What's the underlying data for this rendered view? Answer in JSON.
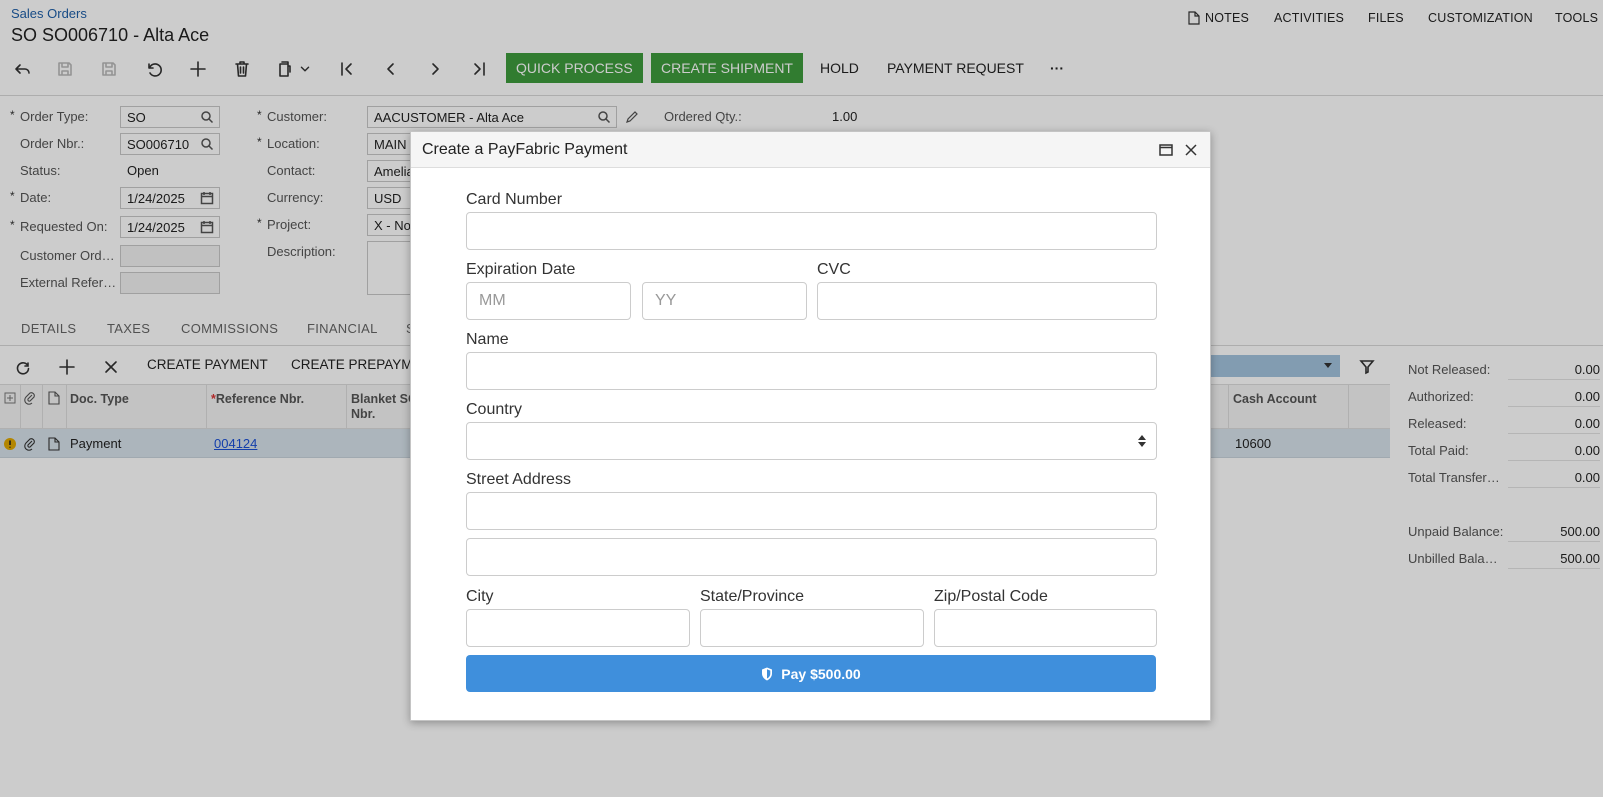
{
  "header": {
    "breadcrumb": "Sales Orders",
    "title": "SO SO006710 - Alta Ace",
    "top_buttons": {
      "notes": "NOTES",
      "activities": "ACTIVITIES",
      "files": "FILES",
      "customization": "CUSTOMIZATION",
      "tools": "TOOLS"
    }
  },
  "toolbar": {
    "quick_process": "QUICK PROCESS",
    "create_shipment": "CREATE SHIPMENT",
    "hold": "HOLD",
    "payment_request": "PAYMENT REQUEST",
    "more": "···"
  },
  "form": {
    "order_type": {
      "label": "Order Type:",
      "value": "SO"
    },
    "order_nbr": {
      "label": "Order Nbr.:",
      "value": "SO006710"
    },
    "status": {
      "label": "Status:",
      "value": "Open"
    },
    "date": {
      "label": "Date:",
      "value": "1/24/2025"
    },
    "requested_on": {
      "label": "Requested On:",
      "value": "1/24/2025"
    },
    "customer_ord": {
      "label": "Customer Ord…",
      "value": ""
    },
    "external_ref": {
      "label": "External Refer…",
      "value": ""
    },
    "customer": {
      "label": "Customer:",
      "value": "AACUSTOMER - Alta Ace"
    },
    "location": {
      "label": "Location:",
      "value": "MAIN"
    },
    "contact": {
      "label": "Contact:",
      "value": "Amelia"
    },
    "currency": {
      "label": "Currency:",
      "value": "USD"
    },
    "project": {
      "label": "Project:",
      "value": "X - No"
    },
    "description": {
      "label": "Description:",
      "value": ""
    },
    "ordered_qty": {
      "label": "Ordered Qty.:",
      "value": "1.00"
    }
  },
  "tabs": [
    "DETAILS",
    "TAXES",
    "COMMISSIONS",
    "FINANCIAL",
    "S"
  ],
  "grid": {
    "buttons": {
      "create_payment": "CREATE PAYMENT",
      "create_prepayment": "CREATE PREPAYM"
    },
    "columns": {
      "doc_type": "Doc. Type",
      "reference_nbr": "Reference Nbr.",
      "blanket_so_1": "Blanket SO",
      "blanket_so_2": "Nbr.",
      "cash_account": "Cash Account"
    },
    "row": {
      "doc_type": "Payment",
      "reference_nbr": "004124",
      "cash_account": "10600"
    }
  },
  "summary": [
    {
      "label": "Not Released:",
      "value": "0.00"
    },
    {
      "label": "Authorized:",
      "value": "0.00"
    },
    {
      "label": "Released:",
      "value": "0.00"
    },
    {
      "label": "Total Paid:",
      "value": "0.00"
    },
    {
      "label": "Total Transferr…",
      "value": "0.00"
    },
    {
      "label": "Unpaid Balance:",
      "value": "500.00"
    },
    {
      "label": "Unbilled Balan…",
      "value": "500.00"
    }
  ],
  "modal": {
    "title": "Create a PayFabric Payment",
    "card_number_label": "Card Number",
    "card_number_value": "",
    "expiration_label": "Expiration Date",
    "month_placeholder": "MM",
    "year_placeholder": "YY",
    "cvc_label": "CVC",
    "name_label": "Name",
    "country_label": "Country",
    "country_value": "",
    "street_label": "Street Address",
    "city_label": "City",
    "state_label": "State/Province",
    "zip_label": "Zip/Postal Code",
    "pay_button": "Pay $500.00"
  },
  "colors": {
    "green": "#3e9b3d",
    "pay_blue": "#3f8fdc",
    "link": "#1f5fa8"
  }
}
